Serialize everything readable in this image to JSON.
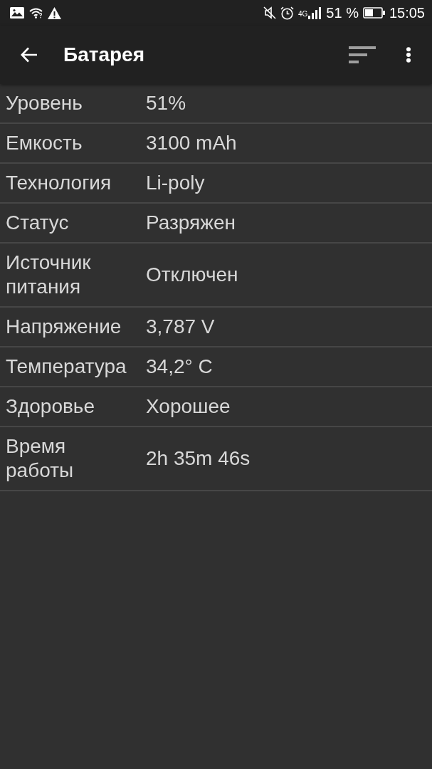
{
  "status_bar": {
    "network": "4G",
    "battery": "51 %",
    "time": "15:05"
  },
  "app_bar": {
    "title": "Батарея"
  },
  "rows": [
    {
      "label": "Уровень",
      "value": "51%"
    },
    {
      "label": "Емкость",
      "value": "3100 mAh"
    },
    {
      "label": "Технология",
      "value": "Li-poly"
    },
    {
      "label": "Статус",
      "value": "Разряжен"
    },
    {
      "label": "Источник питания",
      "value": "Отключен"
    },
    {
      "label": "Напряжение",
      "value": "3,787 V"
    },
    {
      "label": "Температура",
      "value": "34,2° C"
    },
    {
      "label": "Здоровье",
      "value": "Хорошее"
    },
    {
      "label": "Время работы",
      "value": "2h 35m 46s"
    }
  ]
}
